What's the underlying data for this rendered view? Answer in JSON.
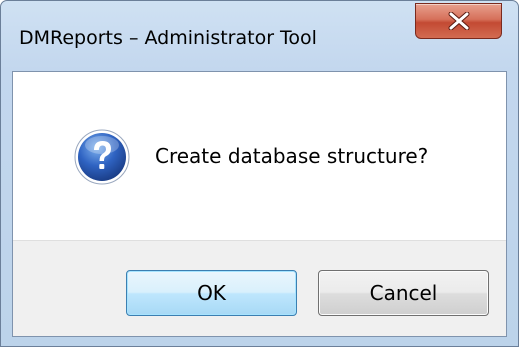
{
  "window": {
    "title": "DMReports – Administrator Tool"
  },
  "dialog": {
    "icon": "question-icon",
    "message": "Create database structure?"
  },
  "buttons": {
    "ok_label": "OK",
    "cancel_label": "Cancel"
  },
  "colors": {
    "close_button": "#c34a33",
    "default_button_border": "#3c7fb1",
    "question_icon": "#2b5aa8"
  }
}
